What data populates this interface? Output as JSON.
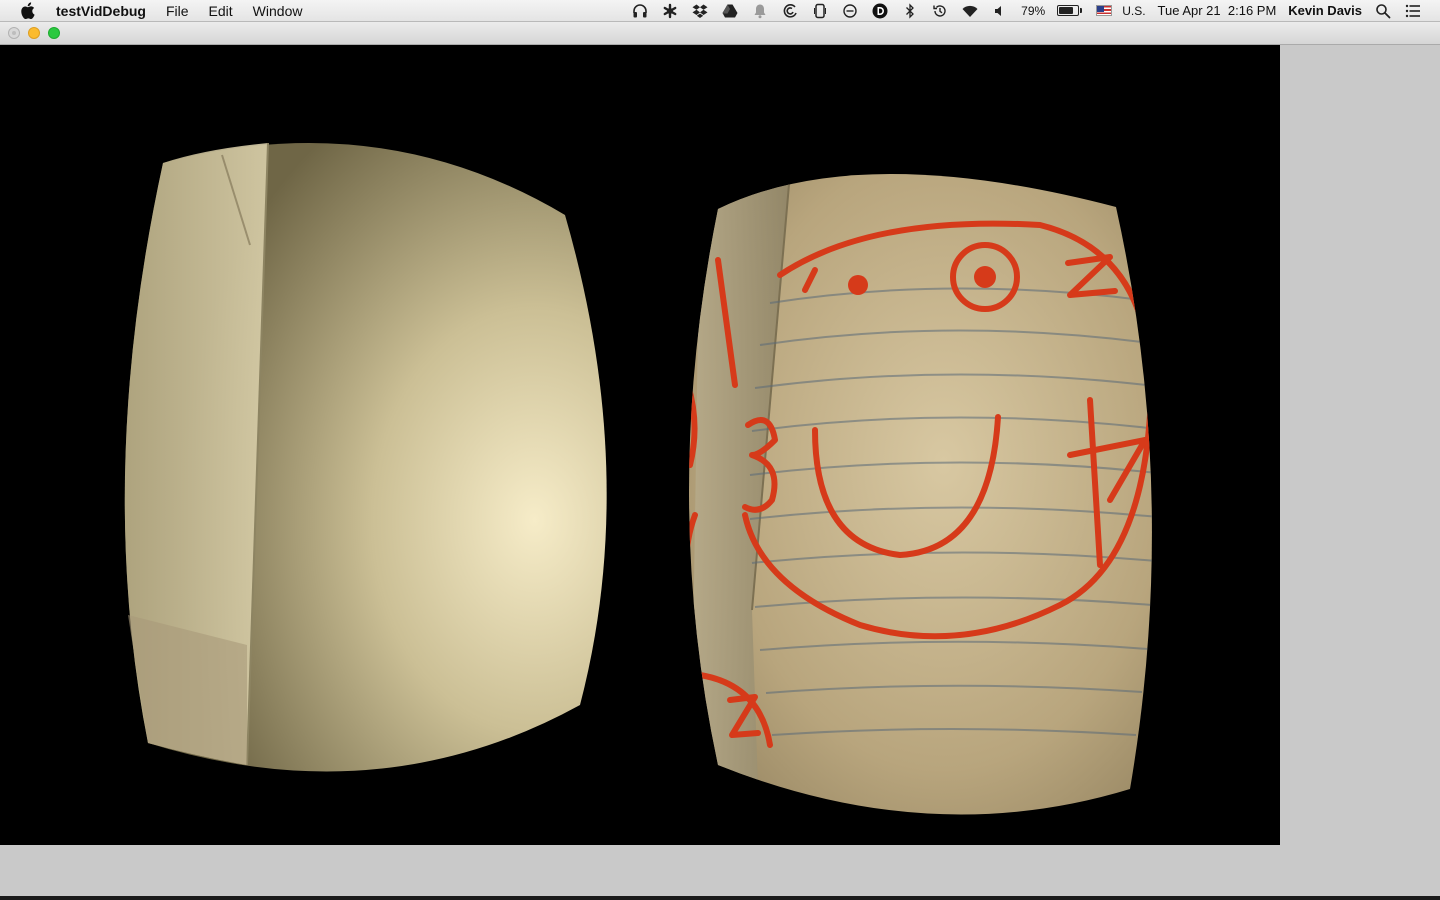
{
  "menubar": {
    "app_name": "testVidDebug",
    "menus": [
      "File",
      "Edit",
      "Window"
    ],
    "status": {
      "battery_percent": "79%",
      "battery_level": 0.79,
      "input_source": "U.S.",
      "datetime": "Tue Apr 21  2:16 PM",
      "user": "Kevin Davis"
    },
    "icons": [
      "headphones-icon",
      "asterisk-icon",
      "dropbox-icon",
      "google-drive-icon",
      "notification-bell-icon",
      "swirl-app-icon",
      "phone-icon",
      "do-not-disturb-icon",
      "d-circle-icon",
      "bluetooth-icon",
      "time-machine-icon",
      "wifi-icon",
      "volume-icon"
    ]
  },
  "window": {
    "traffic_lights": [
      "close",
      "minimize",
      "zoom"
    ],
    "colors": {
      "minimize": "#fbbb2f",
      "zoom": "#2bc940",
      "viewport_bg": "#000000",
      "marker_red": "#d63a1a"
    }
  },
  "video": {
    "left_eye_content": "paper-wall-closeup",
    "right_eye_content": "lined-paper-smiley-drawing",
    "handwriting": [
      "1",
      "2",
      "3",
      "4",
      "Z"
    ]
  }
}
